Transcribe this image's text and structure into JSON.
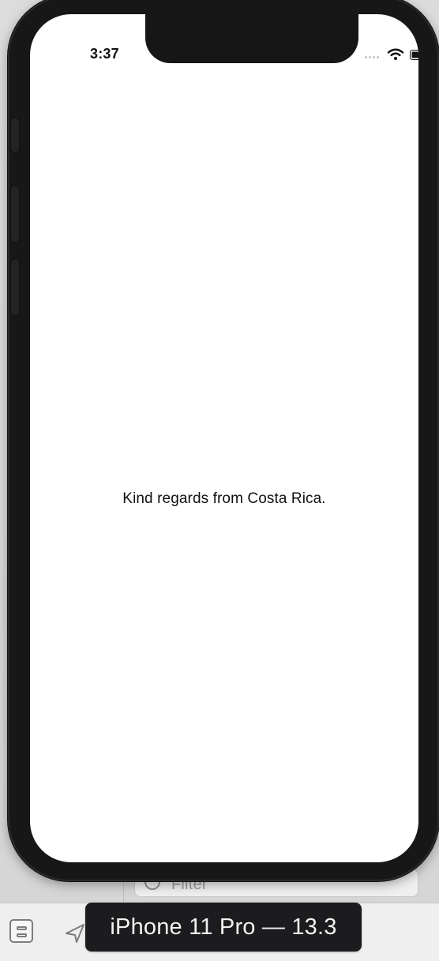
{
  "status_bar": {
    "time": "3:37"
  },
  "screen": {
    "message": "Kind regards from Costa Rica."
  },
  "editor_background": {
    "filter_placeholder": "Filter"
  },
  "simulator_footer": {
    "device_label": "iPhone 11 Pro — 13.3"
  },
  "icons": {
    "wifi": "wifi-icon",
    "battery": "battery-icon",
    "location": "location-icon",
    "debug": "debug-view-icon"
  }
}
